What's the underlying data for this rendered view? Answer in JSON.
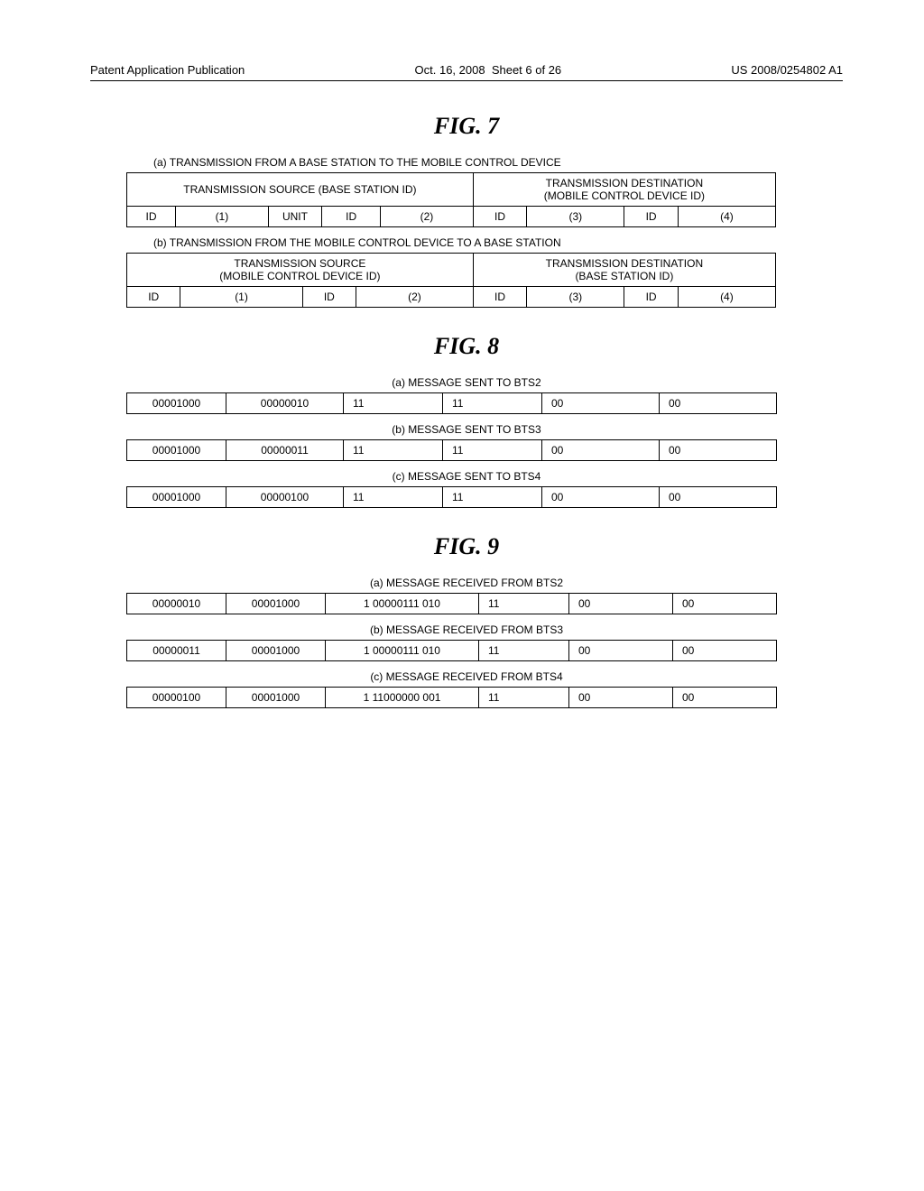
{
  "header": {
    "pub": "Patent Application Publication",
    "date": "Oct. 16, 2008",
    "sheet": "Sheet 6 of 26",
    "pubno": "US 2008/0254802 A1"
  },
  "fig7": {
    "title": "FIG. 7",
    "a": {
      "caption": "(a) TRANSMISSION FROM A BASE STATION TO THE MOBILE CONTROL DEVICE",
      "hsrc": "TRANSMISSION SOURCE (BASE STATION ID)",
      "hdst1": "TRANSMISSION DESTINATION",
      "hdst2": "(MOBILE CONTROL DEVICE ID)",
      "cells": [
        "ID",
        "(1)",
        "UNIT",
        "ID",
        "(2)",
        "ID",
        "(3)",
        "ID",
        "(4)"
      ]
    },
    "b": {
      "caption": "(b) TRANSMISSION FROM THE MOBILE CONTROL DEVICE TO A BASE STATION",
      "hsrc1": "TRANSMISSION SOURCE",
      "hsrc2": "(MOBILE CONTROL DEVICE ID)",
      "hdst1": "TRANSMISSION DESTINATION",
      "hdst2": "(BASE STATION ID)",
      "cells": [
        "ID",
        "(1)",
        "ID",
        "(2)",
        "ID",
        "(3)",
        "ID",
        "(4)"
      ]
    }
  },
  "fig8": {
    "title": "FIG. 8",
    "a": {
      "caption": "(a) MESSAGE SENT TO BTS2",
      "cells": [
        "00001000",
        "00000010",
        "11",
        "11",
        "00",
        "00"
      ]
    },
    "b": {
      "caption": "(b) MESSAGE SENT TO BTS3",
      "cells": [
        "00001000",
        "00000011",
        "11",
        "11",
        "00",
        "00"
      ]
    },
    "c": {
      "caption": "(c) MESSAGE SENT TO BTS4",
      "cells": [
        "00001000",
        "00000100",
        "11",
        "11",
        "00",
        "00"
      ]
    }
  },
  "fig9": {
    "title": "FIG. 9",
    "a": {
      "caption": "(a) MESSAGE RECEIVED FROM BTS2",
      "cells": [
        "00000010",
        "00001000",
        "1 00000111 010",
        "11",
        "00",
        "00"
      ]
    },
    "b": {
      "caption": "(b) MESSAGE RECEIVED FROM BTS3",
      "cells": [
        "00000011",
        "00001000",
        "1 00000111 010",
        "11",
        "00",
        "00"
      ]
    },
    "c": {
      "caption": "(c) MESSAGE RECEIVED FROM BTS4",
      "cells": [
        "00000100",
        "00001000",
        "1 11000000 001",
        "11",
        "00",
        "00"
      ]
    }
  }
}
